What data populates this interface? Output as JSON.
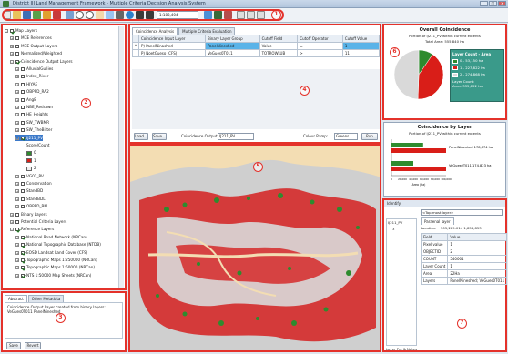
{
  "window": {
    "title": "District III Land Management Framework - Multiple Criteria Decision Analysis System",
    "buttons": [
      "_",
      "□",
      "x"
    ]
  },
  "toolbar": {
    "scale_value": "1:188,404",
    "icons": [
      "new-icon",
      "open-icon",
      "save-icon",
      "add-layer-icon",
      "edit-icon",
      "delete-icon",
      "refresh-icon",
      "zoom-in-icon",
      "zoom-out-icon",
      "pan-icon",
      "full-extent-icon",
      "identify-icon",
      "globe-icon",
      "back-icon",
      "forward-icon",
      "measure-icon",
      "select-icon",
      "clear-icon",
      "info-icon",
      "help-icon"
    ],
    "marker_number": "1"
  },
  "layer_panel": {
    "marker_number": "2",
    "items": [
      {
        "label": "Map Layers",
        "indent": 0,
        "expander": "-",
        "checked": true
      },
      {
        "label": "MCE References",
        "indent": 1,
        "expander": "+",
        "checked": false
      },
      {
        "label": "MCE Output Layers",
        "indent": 1,
        "expander": "+",
        "checked": false
      },
      {
        "label": "Normalized/Weighted",
        "indent": 1,
        "expander": "+",
        "checked": false
      },
      {
        "label": "Coincidence Output Layers",
        "indent": 1,
        "expander": "-",
        "checked": true
      },
      {
        "label": "AlluvialGullies",
        "indent": 2,
        "expander": "+",
        "checked": false
      },
      {
        "label": "Index_River",
        "indent": 2,
        "expander": "+",
        "checked": false
      },
      {
        "label": "HJYAE",
        "indent": 2,
        "expander": "+",
        "checked": false
      },
      {
        "label": "OBPPD_RA2",
        "indent": 2,
        "expander": "+",
        "checked": false
      },
      {
        "label": "Ang8",
        "indent": 2,
        "expander": "+",
        "checked": false
      },
      {
        "label": "NBE_Redrawn",
        "indent": 2,
        "expander": "+",
        "checked": false
      },
      {
        "label": "HE_Heights",
        "indent": 2,
        "expander": "+",
        "checked": false
      },
      {
        "label": "SW_TWBMR",
        "indent": 2,
        "expander": "+",
        "checked": false
      },
      {
        "label": "SW_TheBitter",
        "indent": 2,
        "expander": "+",
        "checked": false
      },
      {
        "label": "IJ211_PV",
        "indent": 2,
        "expander": "-",
        "checked": true,
        "selected": true
      },
      {
        "label": "Score/Count",
        "indent": 4,
        "expander": "",
        "checked": false,
        "plain": true
      },
      {
        "label": "0",
        "indent": 4,
        "swatch": "#2e8b2e",
        "plain": true
      },
      {
        "label": "1",
        "indent": 4,
        "swatch": "#d91e18",
        "plain": true
      },
      {
        "label": "2",
        "indent": 4,
        "swatch": "#f0f0f0",
        "plain": true
      },
      {
        "label": "VG01_PV",
        "indent": 2,
        "expander": "+",
        "checked": false
      },
      {
        "label": "Conservation",
        "indent": 2,
        "expander": "+",
        "checked": false
      },
      {
        "label": "StandBD",
        "indent": 2,
        "expander": "+",
        "checked": false
      },
      {
        "label": "StandBDL",
        "indent": 2,
        "expander": "+",
        "checked": false
      },
      {
        "label": "OBPPD_BM",
        "indent": 2,
        "expander": "+",
        "checked": false
      },
      {
        "label": "Binary Layers",
        "indent": 1,
        "expander": "+",
        "checked": false
      },
      {
        "label": "Potential Criteria Layers",
        "indent": 1,
        "expander": "+",
        "checked": false
      },
      {
        "label": "Reference Layers",
        "indent": 1,
        "expander": "-",
        "checked": true
      },
      {
        "label": "National Road Network (NRCan)",
        "indent": 2,
        "expander": "+",
        "checked": true
      },
      {
        "label": "National Topographic Database (NTDB)",
        "indent": 2,
        "expander": "+",
        "checked": true
      },
      {
        "label": "EOSD Landsat Land Cover (CFS)",
        "indent": 2,
        "expander": "+",
        "checked": true
      },
      {
        "label": "Topographic Maps 1:250000 (NRCan)",
        "indent": 2,
        "expander": "+",
        "checked": true
      },
      {
        "label": "Topographic Maps 1:50000 (NRCan)",
        "indent": 2,
        "expander": "+",
        "checked": true
      },
      {
        "label": "NTS 1:50000 Map Sheets (NRCan)",
        "indent": 2,
        "expander": "+",
        "checked": true
      }
    ]
  },
  "metadata_panel": {
    "marker_number": "3",
    "tabs": [
      "Abstract",
      "Other Metadata"
    ],
    "text": "Coincidence Output Layer created from binary layers: VeGues0T011 PanelNineshed",
    "buttons": [
      "Save",
      "Revert"
    ]
  },
  "analysis_panel": {
    "marker_number": "4",
    "tabs": [
      "Coincidence Analysis",
      "Multiple Criteria Evaluation"
    ],
    "columns": [
      "",
      "Coincidence Input Layer",
      "Binary Layer Group",
      "Cutoff Field",
      "Cutoff Operator",
      "Cutoff Value"
    ],
    "rows": [
      [
        "*",
        "P) PanelNinashed",
        "PanelNineshed",
        "Value",
        "=",
        "1"
      ],
      [
        "",
        "P) NoetGueso (CFS)",
        "VeGues0T011",
        "TOTROWLUB",
        ">",
        "11"
      ]
    ],
    "buttons": [
      "Load...",
      "Save..."
    ],
    "output_label": "Coincidence Output:",
    "output_value": "IJ211_PV",
    "ramp_label": "Colour Ramp:",
    "ramp_value": "Greens",
    "run_label": "Run"
  },
  "map_panel": {
    "marker_number": "5"
  },
  "overall_panel": {
    "marker_number": "6",
    "title": "Overall Coincidence",
    "subtitle": "Portion of IJ211_PV within current extents",
    "total": "Total Area: 555 840 ha",
    "legend_title": "Layer Count - Area",
    "legend": [
      {
        "label": "0 - 53,150 ha",
        "color": "#2e8b2e"
      },
      {
        "label": "1 - 227,822 ha",
        "color": "#d91e18"
      },
      {
        "label": "2 - 274,868 ha",
        "color": "#d9d9d9"
      }
    ],
    "legend_extra": [
      "Layer Count:",
      "Area: 335,822 ha"
    ],
    "pie": [
      {
        "value": 53150,
        "color": "#2e8b2e"
      },
      {
        "value": 227822,
        "color": "#d91e18"
      },
      {
        "value": 274868,
        "color": "#d9d9d9"
      }
    ]
  },
  "layer_chart_panel": {
    "title": "Coincidence by Layer",
    "subtitle": "Portion of IJ211_PV within current extents",
    "xlabel": "Area (ha)",
    "ticks": [
      "0",
      "20,000",
      "40,000",
      "60,000",
      "80,000",
      "100,000"
    ],
    "labels": [
      "PanelNineshed 178,074 ha",
      "VeGues0T011 174,823 ha"
    ],
    "chart_data": {
      "type": "bar",
      "categories": [
        "PanelNineshed",
        "VeGues0T011"
      ],
      "series": [
        {
          "name": "0",
          "values": [
            58000,
            40000
          ]
        },
        {
          "name": "1",
          "values": [
            178074,
            174823
          ]
        }
      ],
      "xlim": [
        0,
        100000
      ]
    }
  },
  "identify_panel": {
    "marker_number": "7",
    "title": "Identify",
    "dropdown": "<Top-most layer>",
    "tab": "Paraenal layer",
    "tree": [
      "IJ211_PV",
      "3"
    ],
    "location_label": "Location:",
    "location_value": "505,289.014 1,856,853",
    "field_col": "Field",
    "value_col": "Value",
    "fields": [
      [
        "Pixel value",
        "1"
      ],
      [
        "OBJECTID",
        "2"
      ],
      [
        "COUNT",
        "540001"
      ],
      [
        "Layer Count",
        "1"
      ],
      [
        "Area",
        "22Ha"
      ],
      [
        "Layers",
        "PanelNineshed; VeGues0T011"
      ]
    ],
    "footer": "Layer Pct & Notes"
  }
}
